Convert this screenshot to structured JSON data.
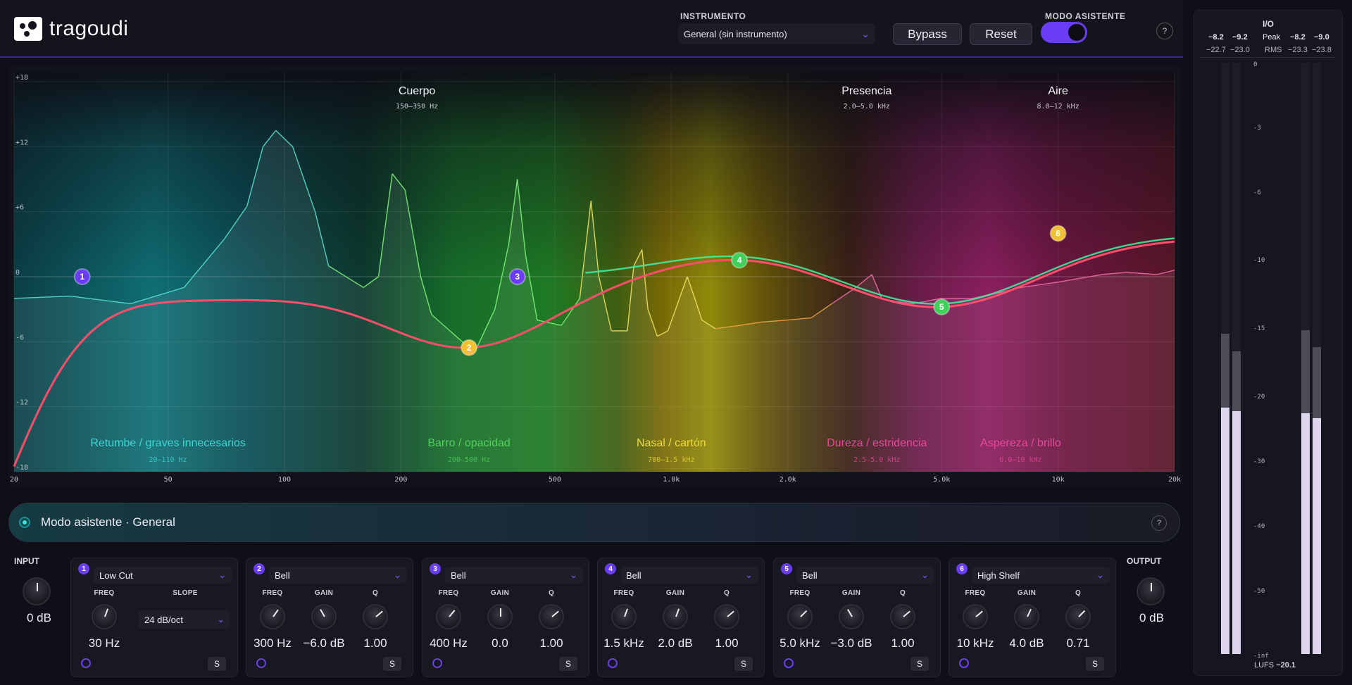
{
  "header": {
    "logo_text": "tragoudi",
    "instrument_label": "INSTRUMENTO",
    "instrument_value": "General (sin instrumento)",
    "bypass_label": "Bypass",
    "reset_label": "Reset",
    "assistant_mode_label": "MODO ASISTENTE",
    "assistant_mode_on": true,
    "help_label": "?"
  },
  "eq": {
    "db_ticks": [
      "+18",
      "+12",
      "+6",
      "0",
      "-6",
      "-12",
      "-18"
    ],
    "freq_ticks": [
      "20",
      "50",
      "100",
      "200",
      "500",
      "1.0k",
      "2.0k",
      "5.0k",
      "10k",
      "20k"
    ],
    "zones_top": [
      {
        "name": "Cuerpo",
        "range": "150–350 Hz"
      },
      {
        "name": "Presencia",
        "range": "2.0–5.0 kHz"
      },
      {
        "name": "Aire",
        "range": "8.0–12 kHz"
      }
    ],
    "zones_bottom": [
      {
        "name": "Retumbe / graves innecesarios",
        "range": "20–110 Hz",
        "color": "#3fd6d6"
      },
      {
        "name": "Barro / opacidad",
        "range": "200–500 Hz",
        "color": "#4fd15a"
      },
      {
        "name": "Nasal / cartón",
        "range": "700–1.5 kHz",
        "color": "#f0d93a"
      },
      {
        "name": "Dureza / estridencia",
        "range": "2.5–5.0 kHz",
        "color": "#e8479a"
      },
      {
        "name": "Aspereza / brillo",
        "range": "6.0–10 kHz",
        "color": "#e8479a"
      }
    ],
    "nodes": [
      {
        "n": "1",
        "freq_hz": 30,
        "gain_db": 0,
        "color": "#6a3df5"
      },
      {
        "n": "2",
        "freq_hz": 300,
        "gain_db": -6.0,
        "color": "#f0c030"
      },
      {
        "n": "3",
        "freq_hz": 400,
        "gain_db": 0,
        "color": "#6a3df5"
      },
      {
        "n": "4",
        "freq_hz": 1500,
        "gain_db": 2.0,
        "color": "#3fcf5a"
      },
      {
        "n": "5",
        "freq_hz": 5000,
        "gain_db": -3.0,
        "color": "#3fcf5a"
      },
      {
        "n": "6",
        "freq_hz": 10000,
        "gain_db": 4.0,
        "color": "#f0c030"
      }
    ]
  },
  "assistant_bar": {
    "text": "Modo asistente · General",
    "help_label": "?"
  },
  "input": {
    "label": "INPUT",
    "value": "0 dB"
  },
  "output": {
    "label": "OUTPUT",
    "value": "0 dB"
  },
  "bands": [
    {
      "num": "1",
      "type": "Low Cut",
      "params": [
        {
          "label": "FREQ",
          "value": "30 Hz"
        }
      ],
      "slope_label": "SLOPE",
      "slope_value": "24 dB/oct",
      "solo": "S"
    },
    {
      "num": "2",
      "type": "Bell",
      "params": [
        {
          "label": "FREQ",
          "value": "300 Hz"
        },
        {
          "label": "GAIN",
          "value": "−6.0 dB"
        },
        {
          "label": "Q",
          "value": "1.00"
        }
      ],
      "solo": "S"
    },
    {
      "num": "3",
      "type": "Bell",
      "params": [
        {
          "label": "FREQ",
          "value": "400 Hz"
        },
        {
          "label": "GAIN",
          "value": "0.0"
        },
        {
          "label": "Q",
          "value": "1.00"
        }
      ],
      "solo": "S"
    },
    {
      "num": "4",
      "type": "Bell",
      "params": [
        {
          "label": "FREQ",
          "value": "1.5 kHz"
        },
        {
          "label": "GAIN",
          "value": "2.0 dB"
        },
        {
          "label": "Q",
          "value": "1.00"
        }
      ],
      "solo": "S"
    },
    {
      "num": "5",
      "type": "Bell",
      "params": [
        {
          "label": "FREQ",
          "value": "5.0 kHz"
        },
        {
          "label": "GAIN",
          "value": "−3.0 dB"
        },
        {
          "label": "Q",
          "value": "1.00"
        }
      ],
      "solo": "S"
    },
    {
      "num": "6",
      "type": "High Shelf",
      "params": [
        {
          "label": "FREQ",
          "value": "10 kHz"
        },
        {
          "label": "GAIN",
          "value": "4.0 dB"
        },
        {
          "label": "Q",
          "value": "0.71"
        }
      ],
      "solo": "S"
    }
  ],
  "io_meters": {
    "title": "I/O",
    "peak_label": "Peak",
    "rms_label": "RMS",
    "in_peak": [
      "−8.2",
      "−9.2"
    ],
    "in_rms": [
      "−22.7",
      "−23.0"
    ],
    "out_peak": [
      "−8.2",
      "−9.0"
    ],
    "out_rms": [
      "−23.3",
      "−23.8"
    ],
    "scale": [
      "0",
      "-3",
      "-6",
      "-10",
      "-15",
      "-20",
      "-30",
      "-40",
      "-50",
      "-inf"
    ],
    "lufs_label": "LUFS",
    "lufs_value": "−20.1"
  }
}
